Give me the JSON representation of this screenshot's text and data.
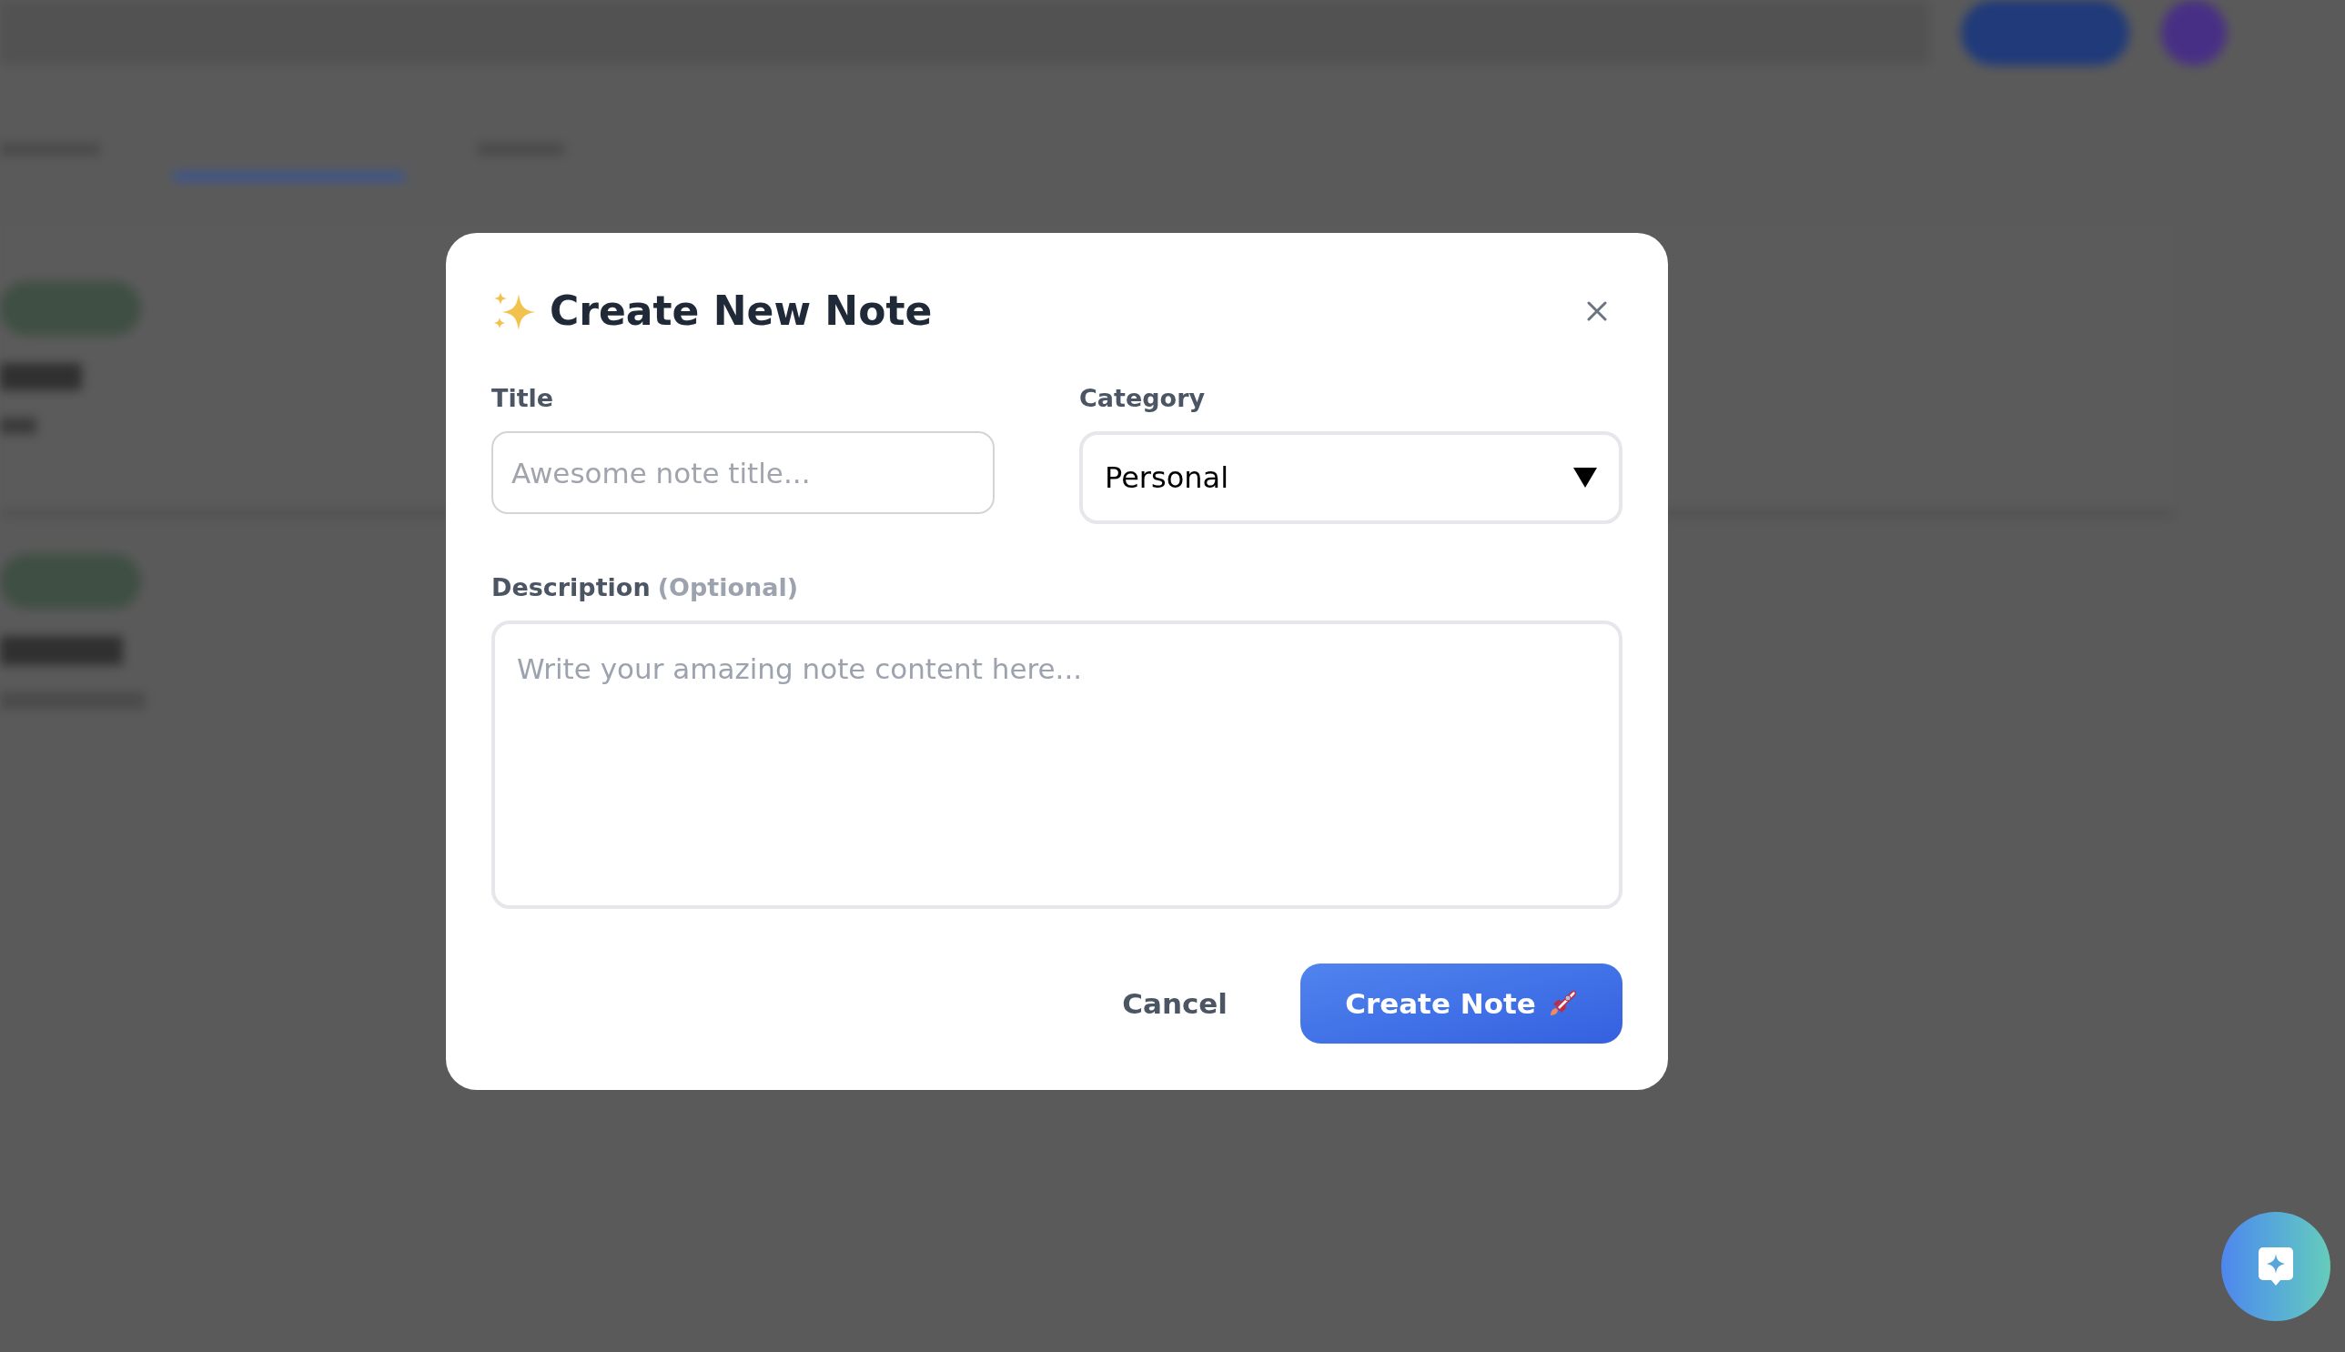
{
  "dialog": {
    "title": "Create New Note",
    "fields": [
      {
        "kind": "text",
        "label": "Title",
        "placeholder": "Awesome note title..."
      },
      {
        "kind": "select",
        "label": "Category",
        "value": "Personal"
      },
      {
        "kind": "textarea",
        "label": "Description",
        "hint": "(Optional)",
        "placeholder": "Write your amazing note content here..."
      }
    ],
    "buttons": [
      {
        "kind": "secondary",
        "label": "Cancel"
      },
      {
        "kind": "primary",
        "label": "Create Note"
      }
    ]
  }
}
